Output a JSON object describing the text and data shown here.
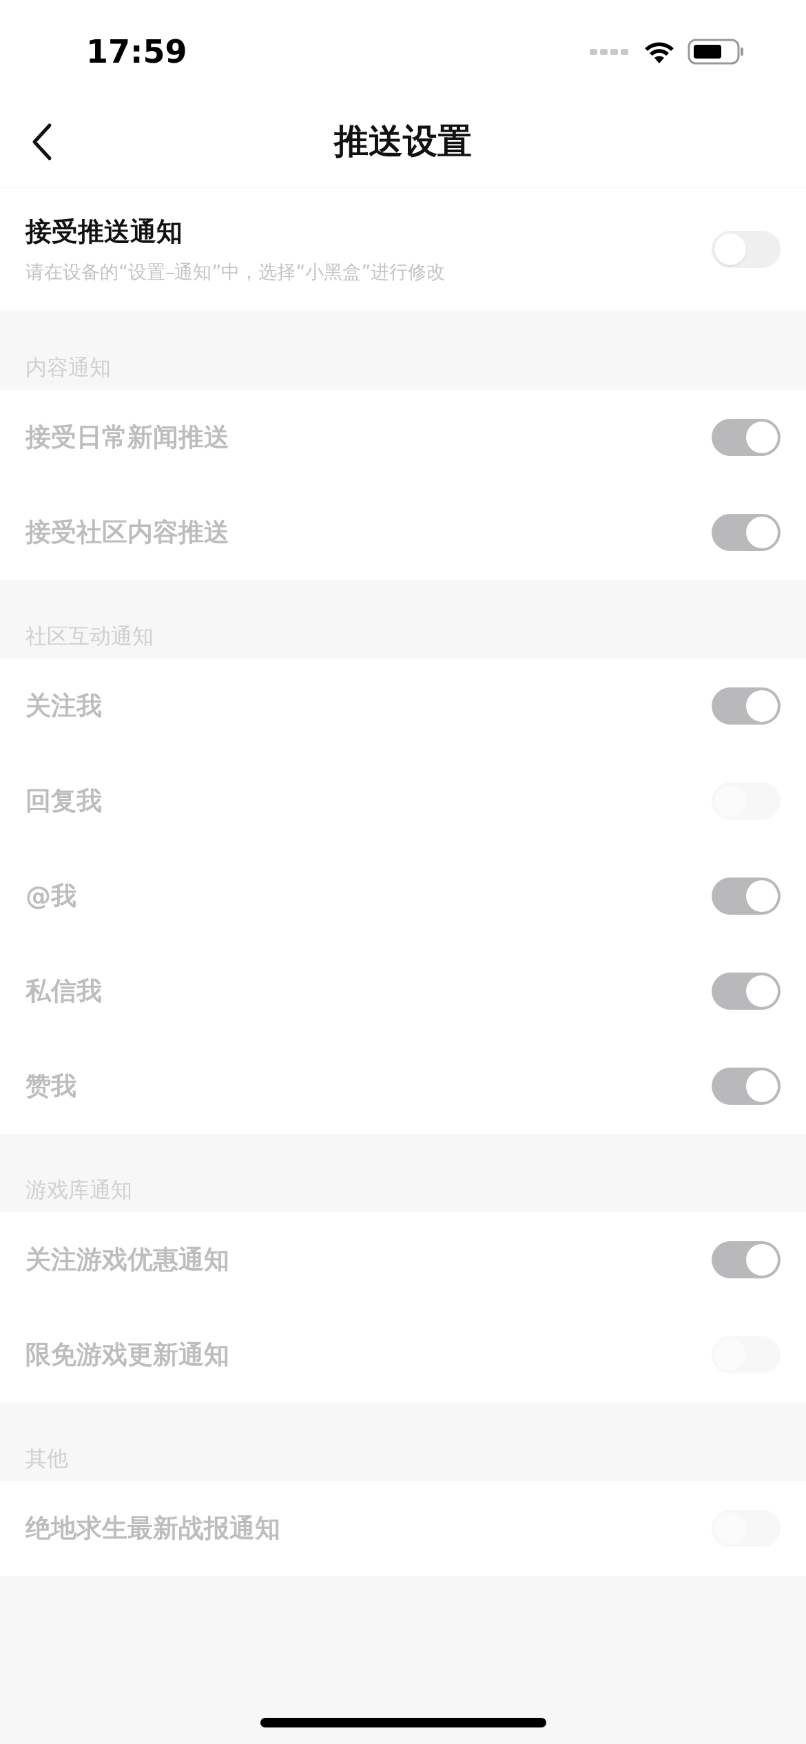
{
  "status_bar": {
    "time": "17:59"
  },
  "nav": {
    "title": "推送设置"
  },
  "master": {
    "label": "接受推送通知",
    "hint": "请在设备的“设置–通知”中，选择“小黑盒”进行修改",
    "on": false,
    "disabled": false
  },
  "sections": [
    {
      "header": "内容通知",
      "items": [
        {
          "label": "接受日常新闻推送",
          "on": true,
          "disabled": true
        },
        {
          "label": "接受社区内容推送",
          "on": true,
          "disabled": true
        }
      ]
    },
    {
      "header": "社区互动通知",
      "items": [
        {
          "label": "关注我",
          "on": true,
          "disabled": true
        },
        {
          "label": "回复我",
          "on": false,
          "disabled": true
        },
        {
          "label": "@我",
          "on": true,
          "disabled": true
        },
        {
          "label": "私信我",
          "on": true,
          "disabled": true
        },
        {
          "label": "赞我",
          "on": true,
          "disabled": true
        }
      ]
    },
    {
      "header": "游戏库通知",
      "items": [
        {
          "label": "关注游戏优惠通知",
          "on": true,
          "disabled": true
        },
        {
          "label": "限免游戏更新通知",
          "on": false,
          "disabled": true
        }
      ]
    },
    {
      "header": "其他",
      "items": [
        {
          "label": "绝地求生最新战报通知",
          "on": false,
          "disabled": true
        }
      ]
    }
  ]
}
